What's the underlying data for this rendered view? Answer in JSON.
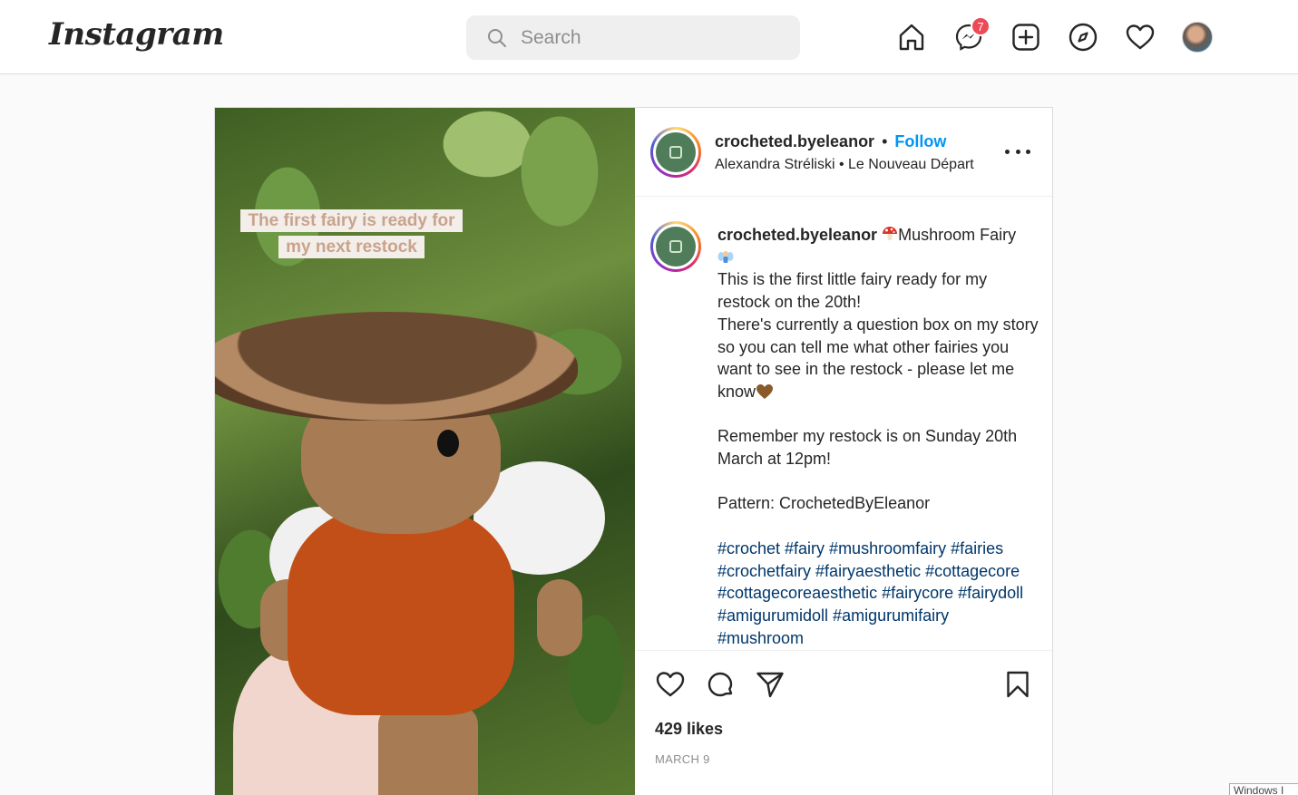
{
  "nav": {
    "logo": "Instagram",
    "search_placeholder": "Search",
    "messenger_badge": "7",
    "icons": [
      "home-icon",
      "messenger-icon",
      "new-post-icon",
      "explore-icon",
      "activity-heart-icon",
      "profile-avatar"
    ]
  },
  "post": {
    "media_caption": "The first fairy is ready for my next restock",
    "header": {
      "username": "crocheted.byeleanor",
      "separator": "•",
      "follow_label": "Follow",
      "audio": "Alexandra Stréliski • Le Nouveau Départ"
    },
    "caption": {
      "username": "crocheted.byeleanor",
      "title": "Mushroom Fairy",
      "body": "This is the first little fairy ready for my restock on the 20th!\nThere's currently a question box on my story so you can tell me what other fairies you want to see in the restock - please let me know",
      "restock": "Remember my restock is on Sunday 20th March at 12pm!",
      "pattern": "Pattern: CrochetedByEleanor",
      "hashtags": "#crochet #fairy #mushroomfairy #fairies #crochetfairy #fairyaesthetic #cottagecore #cottagecoreaesthetic #fairycore #fairydoll #amigurumidoll #amigurumifairy #mushroom"
    },
    "likes": "429 likes",
    "date": "MARCH 9"
  },
  "taskbar_text": "Windows I",
  "colors": {
    "accent_follow": "#0095f6",
    "badge": "#ed4956",
    "hashtag": "#00376b",
    "muted": "#8e8e8e"
  }
}
